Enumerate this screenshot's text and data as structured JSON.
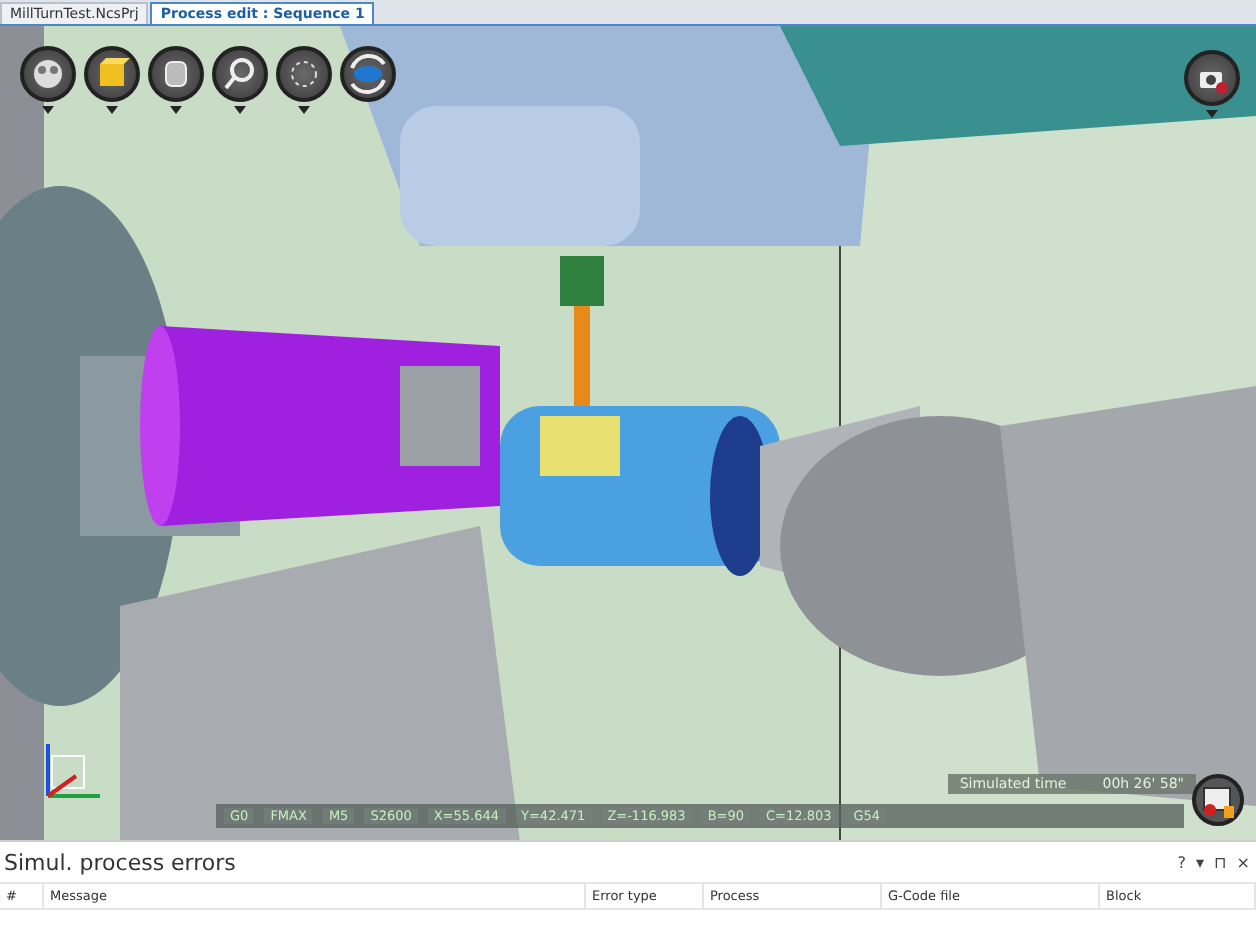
{
  "tabs": [
    {
      "label": "MillTurnTest.NcsPrj",
      "selected": false
    },
    {
      "label": "Process edit : Sequence 1",
      "selected": true
    }
  ],
  "viewport": {
    "toolbar": [
      {
        "kind": "display"
      },
      {
        "kind": "solid"
      },
      {
        "kind": "stock"
      },
      {
        "kind": "zoom"
      },
      {
        "kind": "select"
      },
      {
        "kind": "rotate"
      }
    ],
    "simulated_time": {
      "label": "Simulated time",
      "value": "00h 26' 58\""
    },
    "status_fields": [
      "G0",
      "FMAX",
      "M5",
      "S2600",
      "X=55.644",
      "Y=42.471",
      "Z=-116.983",
      "B=90",
      "C=12.803",
      "G54"
    ]
  },
  "errors_panel": {
    "title": "Simul. process errors",
    "controls": [
      "?",
      "▾",
      "⊓",
      "×"
    ],
    "columns": [
      "#",
      "Message",
      "Error type",
      "Process",
      "G-Code file",
      "Block"
    ]
  }
}
